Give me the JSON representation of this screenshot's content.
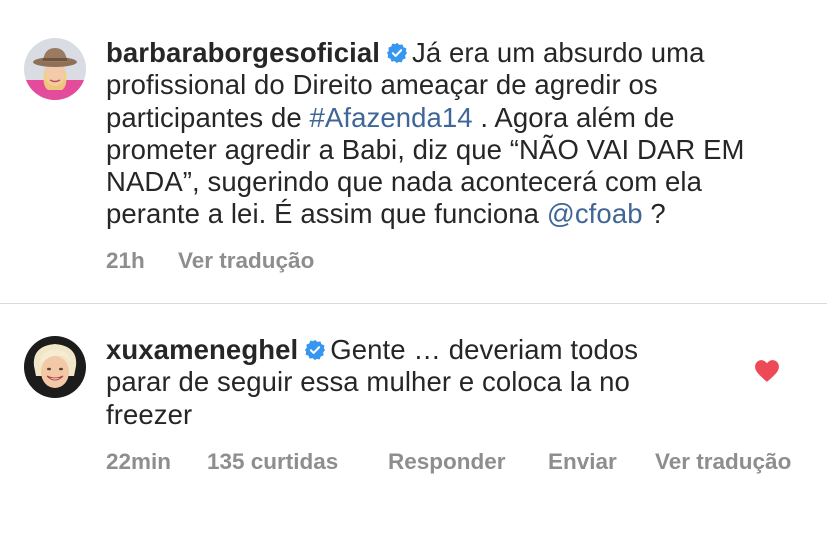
{
  "comments": [
    {
      "username": "barbaraborgesoficial",
      "verified": true,
      "avatar_icon": "woman-with-cowboy-hat-avatar",
      "text_parts": [
        "Já era um absurdo uma profissional do Direito ameaçar de agredir os participantes de ",
        "#Afazenda14",
        " . Agora além de prometer agredir a Babi, diz que “NÃO VAI DAR EM NADA”, sugerindo que nada acontecerá com ela perante a lei. É assim que funciona ",
        "@cfoab",
        " ?"
      ],
      "time": "21h",
      "translate": "Ver tradução"
    },
    {
      "username": "xuxameneghel",
      "verified": true,
      "avatar_icon": "smiling-blonde-woman-avatar",
      "text": "Gente … deveriam todos parar de seguir essa mulher e coloca la no freezer",
      "time": "22min",
      "likes": "135 curtidas",
      "reply": "Responder",
      "send": "Enviar",
      "translate": "Ver tradução",
      "liked": true
    }
  ],
  "colors": {
    "link": "#3f6696",
    "meta": "#8e8e8e",
    "verified": "#3797f0",
    "heart": "#ed4956"
  }
}
